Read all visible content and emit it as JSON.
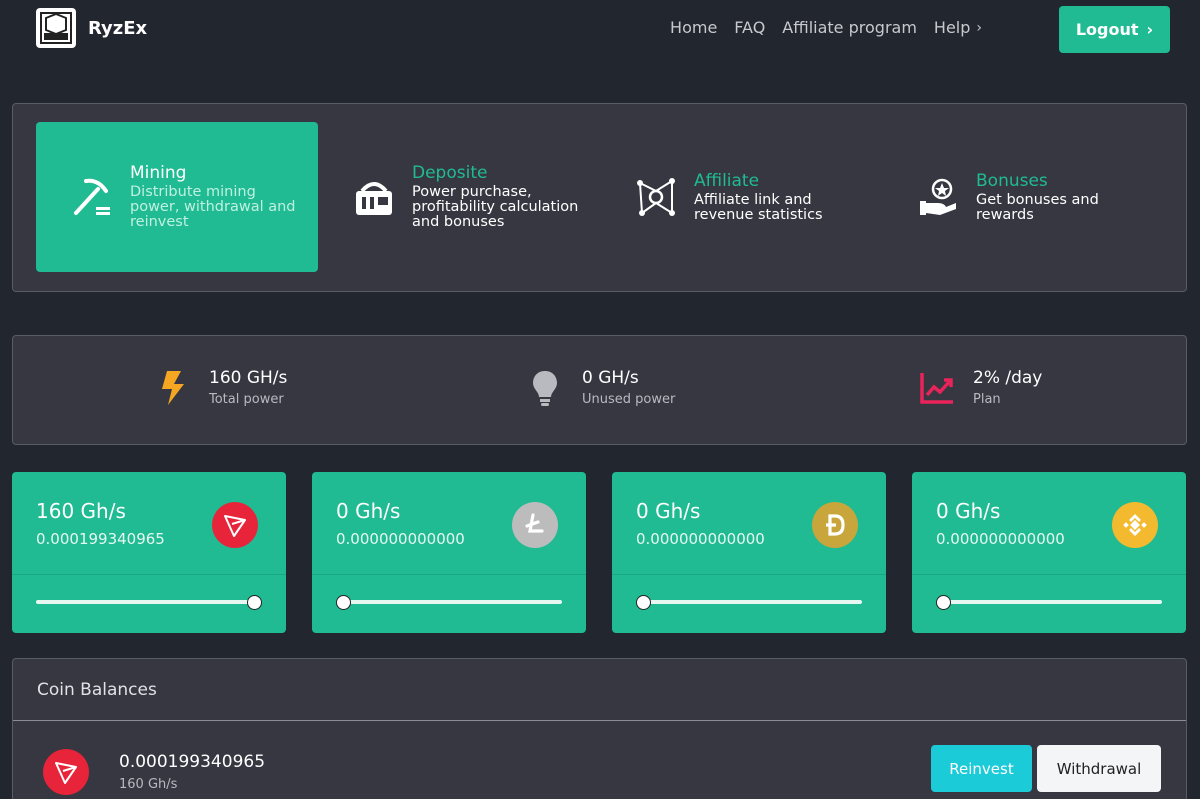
{
  "brand": {
    "name": "RyzEx",
    "logo_text": "RYZEX"
  },
  "nav": {
    "items": [
      "Home",
      "FAQ",
      "Affiliate program",
      "Help"
    ],
    "help_chevron": "›"
  },
  "header": {
    "logout_label": "Logout",
    "logout_chevron": "›"
  },
  "menu": [
    {
      "title": "Mining",
      "desc": "Distribute mining power, withdrawal and reinvest",
      "icon": "pickaxe-icon",
      "active": true
    },
    {
      "title": "Deposite",
      "desc": "Power purchase, profitability calculation and bonuses",
      "icon": "mining-rig-icon",
      "active": false
    },
    {
      "title": "Affiliate",
      "desc": "Affiliate link and revenue statistics",
      "icon": "network-icon",
      "active": false
    },
    {
      "title": "Bonuses",
      "desc": "Get bonuses and rewards",
      "icon": "reward-hand-icon",
      "active": false
    }
  ],
  "stats": [
    {
      "value": "160 GH/s",
      "label": "Total power",
      "icon": "lightning-icon",
      "color": "#f5a623"
    },
    {
      "value": "0 GH/s",
      "label": "Unused power",
      "icon": "lightbulb-icon",
      "color": "#b8bac0"
    },
    {
      "value": "2% /day",
      "label": "Plan",
      "icon": "trend-chart-icon",
      "color": "#e8245a"
    }
  ],
  "coins": [
    {
      "power": "160 Gh/s",
      "amount": "0.000199340965",
      "icon": "tron-icon",
      "color": "#e8243b",
      "slider": 1.0
    },
    {
      "power": "0 Gh/s",
      "amount": "0.000000000000",
      "icon": "litecoin-icon",
      "color": "#bcbcbc",
      "slider": 0.0
    },
    {
      "power": "0 Gh/s",
      "amount": "0.000000000000",
      "icon": "dogecoin-icon",
      "color": "#c8a63c",
      "slider": 0.0
    },
    {
      "power": "0 Gh/s",
      "amount": "0.000000000000",
      "icon": "binance-icon",
      "color": "#f3ba2f",
      "slider": 0.0
    }
  ],
  "balances": {
    "title": "Coin Balances",
    "rows": [
      {
        "amount": "0.000199340965",
        "power": "160 Gh/s",
        "icon": "tron-icon"
      }
    ],
    "reinvest_label": "Reinvest",
    "withdrawal_label": "Withdrawal"
  },
  "colors": {
    "accent": "#20bb92",
    "background": "#22262f",
    "panel": "#363741"
  }
}
